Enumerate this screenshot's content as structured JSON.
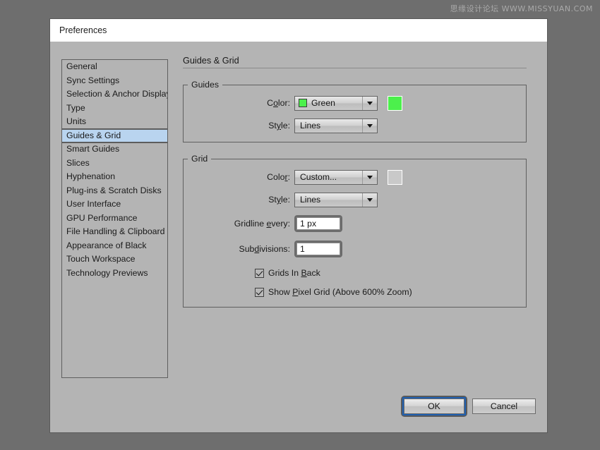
{
  "watermark": "思缘设计论坛  WWW.MISSYUAN.COM",
  "dialog": {
    "title": "Preferences"
  },
  "sidebar": {
    "items": [
      {
        "label": "General",
        "selected": false
      },
      {
        "label": "Sync Settings",
        "selected": false
      },
      {
        "label": "Selection & Anchor Display",
        "selected": false
      },
      {
        "label": "Type",
        "selected": false
      },
      {
        "label": "Units",
        "selected": false
      },
      {
        "label": "Guides & Grid",
        "selected": true
      },
      {
        "label": "Smart Guides",
        "selected": false
      },
      {
        "label": "Slices",
        "selected": false
      },
      {
        "label": "Hyphenation",
        "selected": false
      },
      {
        "label": "Plug-ins & Scratch Disks",
        "selected": false
      },
      {
        "label": "User Interface",
        "selected": false
      },
      {
        "label": "GPU Performance",
        "selected": false
      },
      {
        "label": "File Handling & Clipboard",
        "selected": false
      },
      {
        "label": "Appearance of Black",
        "selected": false
      },
      {
        "label": "Touch Workspace",
        "selected": false
      },
      {
        "label": "Technology Previews",
        "selected": false
      }
    ]
  },
  "pane": {
    "heading": "Guides & Grid",
    "guides": {
      "legend": "Guides",
      "color_label": "Color:",
      "color_label_pre": "C",
      "color_label_accel": "o",
      "color_label_post": "lor:",
      "color_value": "Green",
      "color_hex": "#4cf04c",
      "swatch_hex": "#4cf04c",
      "style_label_pre": "St",
      "style_label_accel": "y",
      "style_label_post": "le:",
      "style_value": "Lines"
    },
    "grid": {
      "legend": "Grid",
      "color_label_pre": "Colo",
      "color_label_accel": "r",
      "color_label_post": ":",
      "color_value": "Custom...",
      "color_hex": "#b8b8b8",
      "swatch_hex": "#c9c9c9",
      "style_label_pre": "St",
      "style_label_accel": "y",
      "style_label_post": "le:",
      "style_value": "Lines",
      "gridline_label_pre": "Gridline ",
      "gridline_label_accel": "e",
      "gridline_label_post": "very:",
      "gridline_value": "1 px",
      "subdivisions_label_pre": "Sub",
      "subdivisions_label_accel": "d",
      "subdivisions_label_post": "ivisions:",
      "subdivisions_value": "1",
      "checkbox_grids_in_back_pre": "Grids In ",
      "checkbox_grids_in_back_accel": "B",
      "checkbox_grids_in_back_post": "ack",
      "checkbox_grids_in_back_checked": true,
      "checkbox_pixel_grid_pre": "Show ",
      "checkbox_pixel_grid_accel": "P",
      "checkbox_pixel_grid_post": "ixel Grid (Above 600% Zoom)",
      "checkbox_pixel_grid_checked": true
    }
  },
  "buttons": {
    "ok": "OK",
    "cancel": "Cancel",
    "focus_color": "#1f5fb0"
  }
}
